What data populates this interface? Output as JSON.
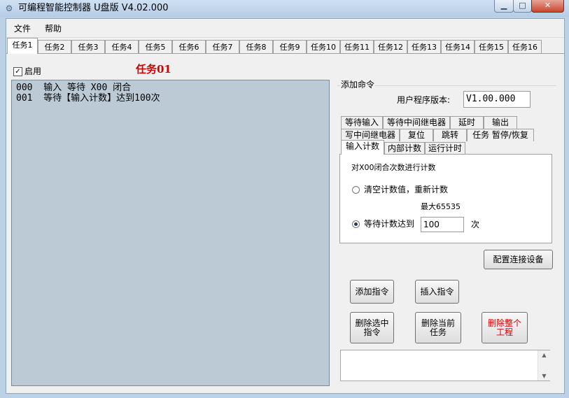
{
  "window": {
    "title": "可编程智能控制器 U盘版 V4.02.000",
    "icon": "gear-icon",
    "minimize_glyph": "▁",
    "maximize_glyph": "□",
    "close_glyph": "✕"
  },
  "menu": {
    "items": [
      "文件",
      "帮助"
    ]
  },
  "task_tabs": [
    "任务1",
    "任务2",
    "任务3",
    "任务4",
    "任务5",
    "任务6",
    "任务7",
    "任务8",
    "任务9",
    "任务10",
    "任务11",
    "任务12",
    "任务13",
    "任务14",
    "任务15",
    "任务16"
  ],
  "active_task_tab": 0,
  "enable": {
    "label": "启用",
    "checked": true,
    "check_glyph": "✓"
  },
  "task_heading": "任务01",
  "program_lines": [
    "000  输入 等待 X00 闭合",
    "001  等待【输入计数】达到100次"
  ],
  "add_command": {
    "group_label": "添加命令",
    "version_label": "用户程序版本:",
    "version_value": "V1.00.000",
    "tabs_row1": [
      "等待输入",
      "等待中间继电器",
      "延时",
      "输出"
    ],
    "tabs_row2": [
      "写中间继电器",
      "复位",
      "跳转",
      "任务 暂停/恢复"
    ],
    "tabs_row3": [
      "输入计数",
      "内部计数",
      "运行计时"
    ],
    "active_tab_row3": 0,
    "panel": {
      "description": "对X00闭合次数进行计数",
      "option_clear": "清空计数值，重新计数",
      "max_label": "最大65535",
      "option_wait": "等待计数达到",
      "count_value": "100",
      "unit": "次",
      "selected_option": "wait"
    }
  },
  "buttons": {
    "config": "配置连接设备",
    "add": "添加指令",
    "insert": "插入指令",
    "delete_selected": [
      "删除选中",
      "指令"
    ],
    "delete_task": [
      "删除当前",
      "任务"
    ],
    "delete_project": [
      "删除整个",
      "工程"
    ]
  },
  "colors": {
    "danger_text": "#d00000",
    "program_bg": "#bccad6",
    "heading": "#d00000"
  },
  "log_scroll": {
    "up_glyph": "▲",
    "down_glyph": "▼"
  }
}
